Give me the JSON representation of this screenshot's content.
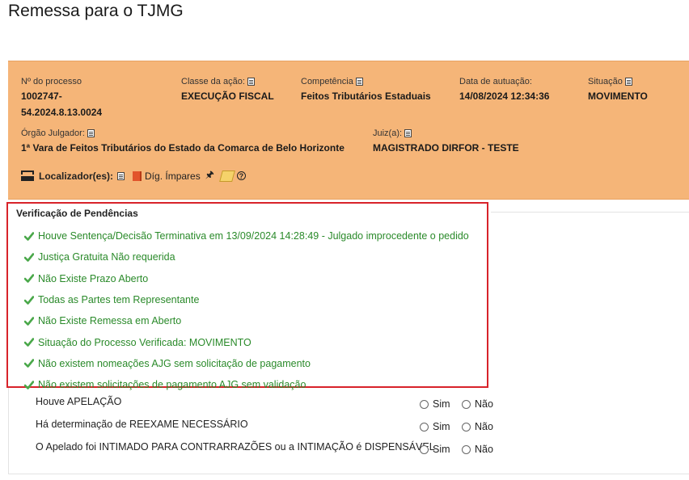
{
  "page": {
    "title": "Remessa para o TJMG"
  },
  "process": {
    "numero_label": "Nº do processo",
    "numero_line1": "1002747-",
    "numero_line2": "54.2024.8.13.0024",
    "classe_label": "Classe da ação:",
    "classe_value": "EXECUÇÃO FISCAL",
    "competencia_label": "Competência",
    "competencia_value": "Feitos Tributários Estaduais",
    "data_label": "Data de autuação:",
    "data_value": "14/08/2024 12:34:36",
    "situacao_label": "Situação",
    "situacao_value": "MOVIMENTO",
    "orgao_label": "Órgão Julgador:",
    "orgao_value": "1ª Vara de Feitos Tributários do Estado da Comarca de Belo Horizonte",
    "juiz_label": "Juiz(a):",
    "juiz_value": "MAGISTRADO DIRFOR - TESTE",
    "localizador_label": "Localizador(es):",
    "localizador_tag": "Díg. Ímpares"
  },
  "pendencias": {
    "title": "Verificação de Pendências",
    "items": [
      "Houve Sentença/Decisão Terminativa em 13/09/2024 14:28:49 - Julgado improcedente o pedido",
      "Justiça Gratuita Não requerida",
      "Não Existe Prazo Aberto",
      "Todas as Partes tem Representante",
      "Não Existe Remessa em Aberto",
      "Situação do Processo Verificada: MOVIMENTO",
      "Não existem nomeações AJG sem solicitação de pagamento",
      "Não existem solicitações de pagamento AJG sem validação"
    ]
  },
  "questions": [
    {
      "text": "Houve APELAÇÃO",
      "yes": "Sim",
      "no": "Não"
    },
    {
      "text": "Há determinação de REEXAME NECESSÁRIO",
      "yes": "Sim",
      "no": "Não"
    },
    {
      "text": "O Apelado foi INTIMADO PARA CONTRARRAZÕES ou a INTIMAÇÃO é DISPENSÁVEL",
      "yes": "Sim",
      "no": "Não"
    }
  ],
  "icons": {
    "check": "check-icon",
    "doc": "document-icon",
    "localizador": "inbox-icon",
    "tag": "book-icon",
    "pin": "pin-icon",
    "edit": "pencil-icon",
    "help": "help-icon"
  },
  "colors": {
    "header_bg": "#f5b578",
    "check_green": "#2a8a2a",
    "highlight_border": "#d8232a"
  }
}
